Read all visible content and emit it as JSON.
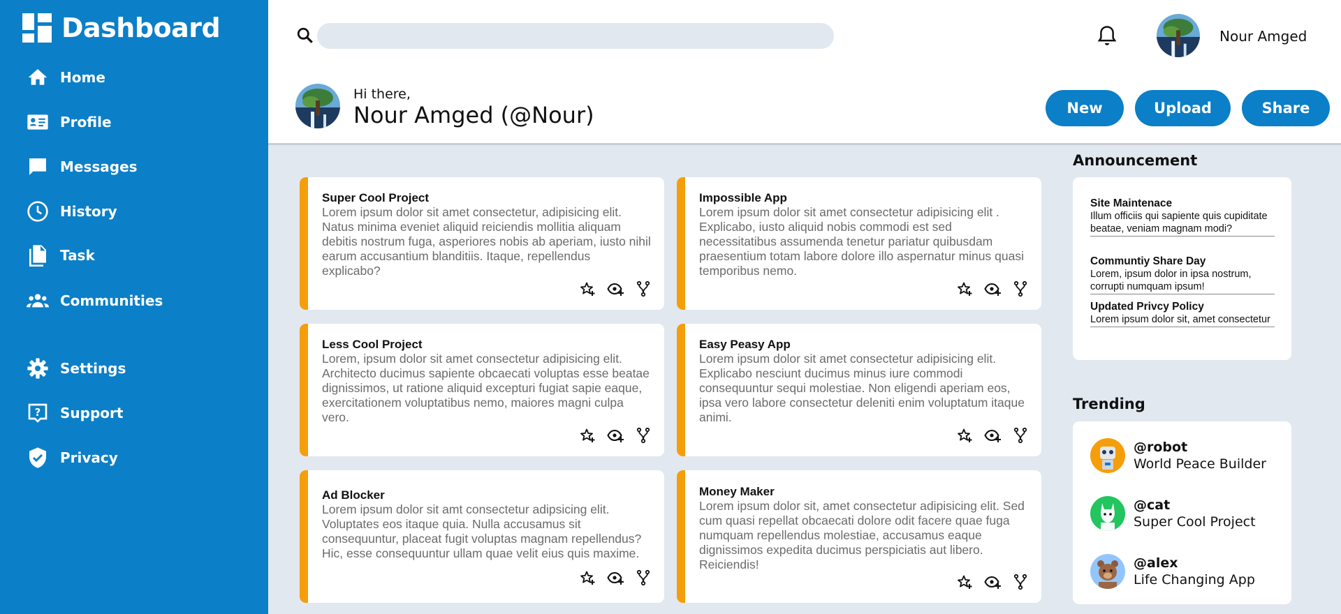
{
  "sidebar": {
    "title": "Dashboard",
    "items": [
      {
        "label": "Home",
        "icon": "home-icon"
      },
      {
        "label": "Profile",
        "icon": "id-card-icon"
      },
      {
        "label": "Messages",
        "icon": "chat-icon"
      },
      {
        "label": "History",
        "icon": "clock-icon"
      },
      {
        "label": "Task",
        "icon": "document-icon"
      },
      {
        "label": "Communities",
        "icon": "group-icon"
      },
      {
        "label": "Settings",
        "icon": "gear-icon"
      },
      {
        "label": "Support",
        "icon": "help-icon"
      },
      {
        "label": "Privacy",
        "icon": "shield-icon"
      }
    ]
  },
  "header": {
    "search_placeholder": "",
    "user_name": "Nour Amged"
  },
  "greeting": {
    "hi": "Hi there,",
    "name": "Nour Amged (@Nour)",
    "buttons": {
      "new": "New",
      "upload": "Upload",
      "share": "Share"
    }
  },
  "projects": [
    {
      "title": "Super Cool Project",
      "desc": "Lorem ipsum dolor sit amet consectetur, adipisicing elit. Natus minima eveniet aliquid reiciendis mollitia aliquam debitis nostrum fuga, asperiores nobis ab aperiam, iusto nihil earum accusantium blanditiis. Itaque, repellendus explicabo?"
    },
    {
      "title": "Impossible App",
      "desc": "Lorem ipsum dolor sit amet consectetur adipisicing elit . Explicabo, iusto aliquid nobis commodi est sed necessitatibus assumenda tenetur pariatur quibusdam praesentium totam labore dolore illo aspernatur minus quasi temporibus nemo."
    },
    {
      "title": "Less Cool Project",
      "desc": "Lorem, ipsum dolor sit amet consectetur adipisicing elit. Architecto ducimus sapiente obcaecati voluptas esse beatae dignissimos, ut ratione aliquid excepturi fugiat sapie eaque, exercitationem voluptatibus nemo, maiores magni culpa vero."
    },
    {
      "title": "Easy Peasy App",
      "desc": "Lorem ipsum dolor sit amet consectetur adipisicing elit. Explicabo nesciunt ducimus minus iure commodi consequuntur sequi molestiae. Non eligendi aperiam eos, ipsa vero labore consectetur deleniti enim voluptatum itaque animi."
    },
    {
      "title": "Ad Blocker",
      "desc": "Lorem ipsum dolor sit amt consectetur adipsicing elit. Voluptates eos itaque quia. Nulla accusamus sit consequuntur, placeat fugit voluptas magnam repellendus? Hic, esse consequuntur ullam quae velit eius quis maxime."
    },
    {
      "title": "Money Maker",
      "desc": "Lorem ipsum dolor sit, amet consectetur adipisicing elit. Sed cum quasi repellat obcaecati dolore odit facere quae fuga numquam repellendus molestiae, accusamus eaque dignissimos expedita ducimus perspiciatis aut libero. Reiciendis!"
    }
  ],
  "announcement": {
    "title": "Announcement",
    "items": [
      {
        "title": "Site Maintenace",
        "body": "Illum officiis qui sapiente quis cupiditate beatae, veniam magnam modi?"
      },
      {
        "title": "Communtiy Share Day",
        "body": "Lorem, ipsum dolor in ipsa nostrum, corrupti numquam ipsum!"
      },
      {
        "title": "Updated Privcy Policy",
        "body": "Lorem ipsum dolor sit, amet consectetur"
      }
    ]
  },
  "trending": {
    "title": "Trending",
    "items": [
      {
        "handle": "@robot",
        "project": "World Peace Builder",
        "avatar": "robot-avatar"
      },
      {
        "handle": "@cat",
        "project": "Super Cool Project",
        "avatar": "cat-avatar"
      },
      {
        "handle": "@alex",
        "project": "Life Changing App",
        "avatar": "bear-avatar"
      }
    ]
  },
  "colors": {
    "brand": "#0b7fc7",
    "accent": "#f59e0b",
    "background": "#e2e8f0"
  }
}
